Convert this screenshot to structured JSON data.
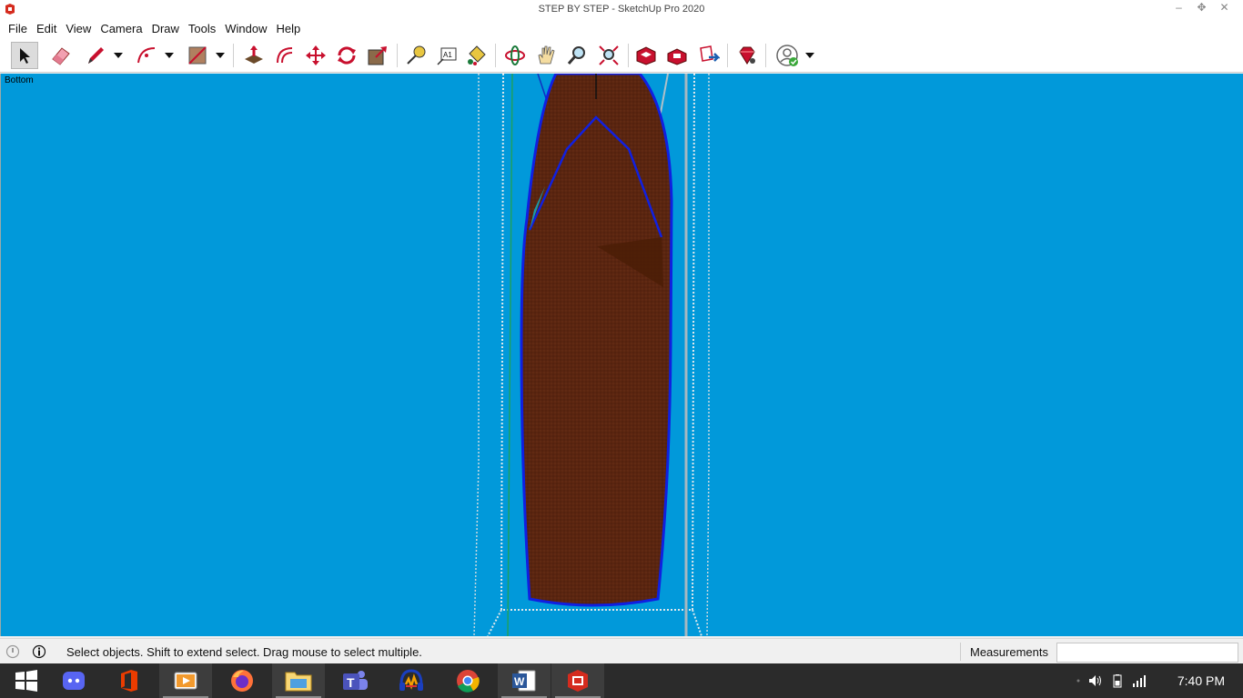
{
  "window": {
    "title": "STEP BY STEP - SketchUp Pro 2020",
    "minimize_label": "‒",
    "maximize_label": "✥",
    "close_label": "✕"
  },
  "menu": {
    "items": [
      "File",
      "Edit",
      "View",
      "Camera",
      "Draw",
      "Tools",
      "Window",
      "Help"
    ]
  },
  "toolbar": {
    "tools": [
      {
        "name": "select-tool",
        "icon": "arrow-cursor-icon"
      },
      {
        "name": "eraser-tool",
        "icon": "eraser-icon"
      },
      {
        "name": "line-tool",
        "icon": "pencil-icon"
      },
      {
        "name": "arc-tool",
        "icon": "arc-icon"
      },
      {
        "name": "rectangle-tool",
        "icon": "rectangle-icon"
      },
      {
        "name": "push-pull-tool",
        "icon": "push-pull-icon"
      },
      {
        "name": "offset-tool",
        "icon": "offset-icon"
      },
      {
        "name": "move-tool",
        "icon": "move-icon"
      },
      {
        "name": "rotate-tool",
        "icon": "rotate-icon"
      },
      {
        "name": "scale-tool",
        "icon": "scale-icon"
      },
      {
        "name": "tape-measure-tool",
        "icon": "tape-measure-icon"
      },
      {
        "name": "text-tool",
        "icon": "text-icon"
      },
      {
        "name": "paint-bucket-tool",
        "icon": "paint-bucket-icon"
      },
      {
        "name": "orbit-tool",
        "icon": "orbit-icon"
      },
      {
        "name": "pan-tool",
        "icon": "hand-icon"
      },
      {
        "name": "zoom-tool",
        "icon": "magnifier-icon"
      },
      {
        "name": "zoom-extents-tool",
        "icon": "zoom-extents-icon"
      },
      {
        "name": "3d-warehouse-button",
        "icon": "warehouse-icon"
      },
      {
        "name": "extension-warehouse-button",
        "icon": "extension-warehouse-icon"
      },
      {
        "name": "send-to-layout-button",
        "icon": "layout-icon"
      },
      {
        "name": "extension-manager-button",
        "icon": "ruby-icon"
      },
      {
        "name": "account-button",
        "icon": "user-account-icon"
      }
    ],
    "text_tool_glyph": "A1"
  },
  "viewport": {
    "scene_label": "Bottom",
    "background_color": "#0199da"
  },
  "status": {
    "hint": "Select objects. Shift to extend select. Drag mouse to select multiple.",
    "measurements_label": "Measurements",
    "measurements_value": ""
  },
  "taskbar": {
    "apps": [
      {
        "name": "start",
        "icon": "windows-icon"
      },
      {
        "name": "discord",
        "icon": "discord-icon"
      },
      {
        "name": "office",
        "icon": "office-icon"
      },
      {
        "name": "media-player",
        "icon": "video-player-icon"
      },
      {
        "name": "firefox",
        "icon": "firefox-icon"
      },
      {
        "name": "file-explorer",
        "icon": "folder-icon"
      },
      {
        "name": "teams",
        "icon": "teams-icon"
      },
      {
        "name": "audio-app",
        "icon": "headphones-icon"
      },
      {
        "name": "chrome",
        "icon": "chrome-icon"
      },
      {
        "name": "word",
        "icon": "word-icon"
      },
      {
        "name": "sketchup",
        "icon": "sketchup-icon"
      }
    ],
    "clock": "7:40 PM"
  }
}
